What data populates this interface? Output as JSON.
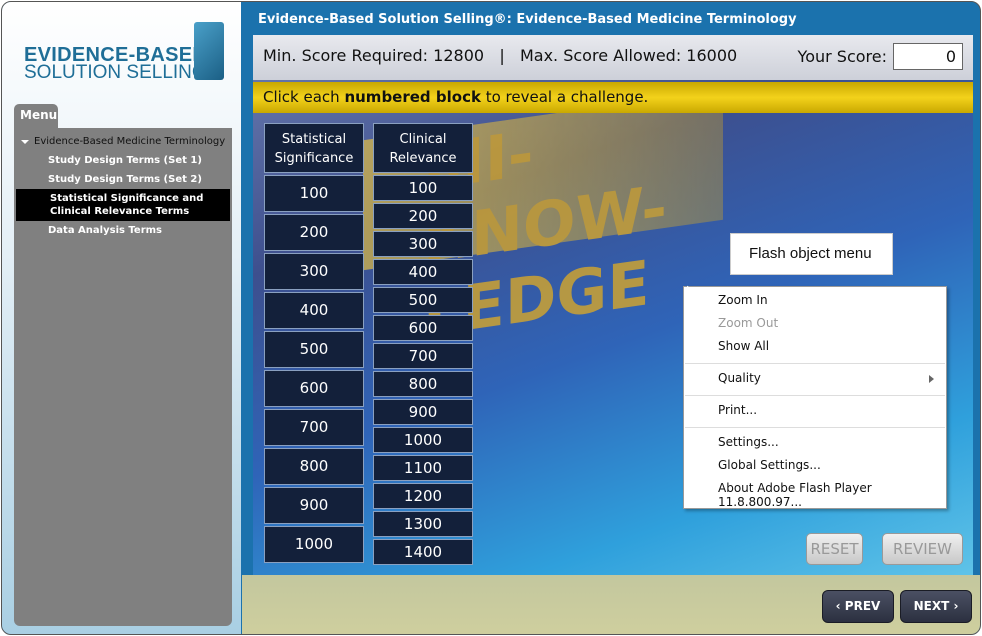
{
  "logo": {
    "line1": "EVIDENCE-BASED",
    "line2": "SOLUTION SELLING®"
  },
  "menu": {
    "tab": "Menu",
    "items": [
      {
        "label": "Evidence-Based Medicine Terminology"
      },
      {
        "label": "Study Design Terms (Set 1)"
      },
      {
        "label": "Study Design Terms (Set 2)"
      },
      {
        "label": "Statistical Significance and Clinical Relevance Terms",
        "selected": true
      },
      {
        "label": "Data Analysis Terms"
      }
    ]
  },
  "header": {
    "title": "Evidence-Based Solution Selling®: Evidence-Based Medicine Terminology"
  },
  "score": {
    "min": "Min. Score Required: 12800",
    "sep": "|",
    "max": "Max. Score Allowed: 16000",
    "your_label": "Your Score:",
    "your_value": "0"
  },
  "instruction": {
    "pre": "Click each ",
    "bold": "numbered block",
    "post": " to reveal a challenge."
  },
  "columns": [
    {
      "title": "Statistical Significance",
      "blocks": [
        "100",
        "200",
        "300",
        "400",
        "500",
        "600",
        "700",
        "800",
        "900",
        "1000"
      ]
    },
    {
      "title": "Clinical Relevance",
      "blocks": [
        "100",
        "200",
        "300",
        "400",
        "500",
        "600",
        "700",
        "800",
        "900",
        "1000",
        "1100",
        "1200",
        "1300",
        "1400"
      ]
    }
  ],
  "buttons": {
    "reset": "RESET",
    "review": "REVIEW",
    "prev": "PREV",
    "next": "NEXT"
  },
  "tooltip": "Flash object menu",
  "context_menu": [
    {
      "label": "Zoom In"
    },
    {
      "label": "Zoom Out",
      "disabled": true
    },
    {
      "label": "Show All"
    },
    {
      "sep": true
    },
    {
      "label": "Quality",
      "submenu": true
    },
    {
      "sep": true
    },
    {
      "label": "Print..."
    },
    {
      "sep": true
    },
    {
      "label": "Settings..."
    },
    {
      "label": "Global Settings..."
    },
    {
      "label": "About Adobe Flash Player 11.8.800.97..."
    }
  ]
}
